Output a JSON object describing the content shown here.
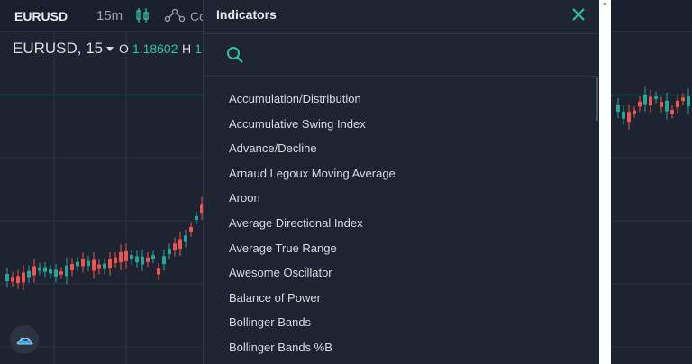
{
  "topbar": {
    "symbol": "EURUSD",
    "interval": "15m",
    "compare_label": "Co"
  },
  "legend": {
    "title": "EURUSD, 15",
    "open_key": "O",
    "open_value": "1.18602",
    "high_key": "H",
    "high_value": "1."
  },
  "panel": {
    "title": "Indicators",
    "search_placeholder": "",
    "items": [
      "Accumulation/Distribution",
      "Accumulative Swing Index",
      "Advance/Decline",
      "Arnaud Legoux Moving Average",
      "Aroon",
      "Average Directional Index",
      "Average True Range",
      "Awesome Oscillator",
      "Balance of Power",
      "Bollinger Bands",
      "Bollinger Bands %B"
    ]
  },
  "colors": {
    "up": "#26a69a",
    "down": "#ef5350",
    "accent": "#26c6a1"
  },
  "icons": {
    "candles": "candlestick-icon",
    "compare": "compare-icon",
    "close": "close-icon",
    "search": "search-icon",
    "logo": "cloud-logo-icon"
  }
}
